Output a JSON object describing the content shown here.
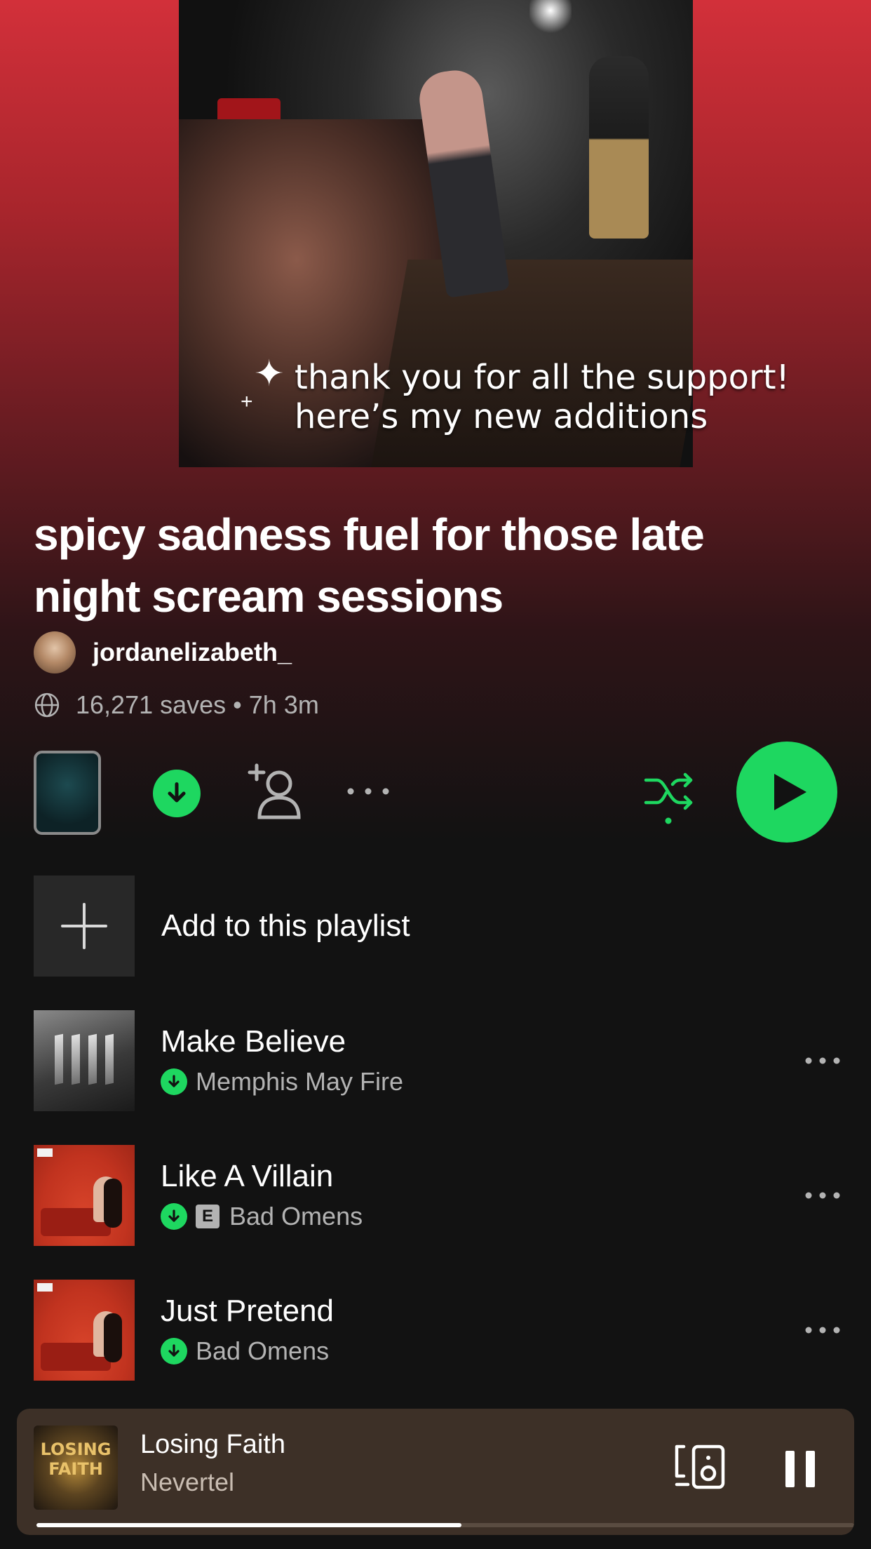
{
  "cover": {
    "caption_line1": "thank you for all the support!",
    "caption_line2": "here’s my new additions",
    "sparkle_big": "✦",
    "sparkle_small": "+"
  },
  "playlist": {
    "title": "spicy sadness fuel for those late night scream sessions",
    "owner": "jordanelizabeth_",
    "meta": "16,271 saves • 7h 3m"
  },
  "actions": {
    "download_icon": "download-icon",
    "add_collaborator_icon": "add-user-icon",
    "more_icon": "more-icon",
    "shuffle_icon": "shuffle-icon",
    "play_icon": "play-icon",
    "accent_color": "#1ed760"
  },
  "add_row": {
    "label": "Add to this playlist"
  },
  "tracks": [
    {
      "title": "Make Believe",
      "artist": "Memphis May Fire",
      "downloaded": true,
      "explicit": false
    },
    {
      "title": "Like A Villain",
      "artist": "Bad Omens",
      "downloaded": true,
      "explicit": true,
      "explicit_label": "E"
    },
    {
      "title": "Just Pretend",
      "artist": "Bad Omens",
      "downloaded": true,
      "explicit": false
    }
  ],
  "now_playing": {
    "title": "Losing Faith",
    "artist": "Nevertel",
    "art_text": "LOSING FAITH",
    "progress_fraction": 0.52,
    "bg_color": "#3d3027"
  }
}
